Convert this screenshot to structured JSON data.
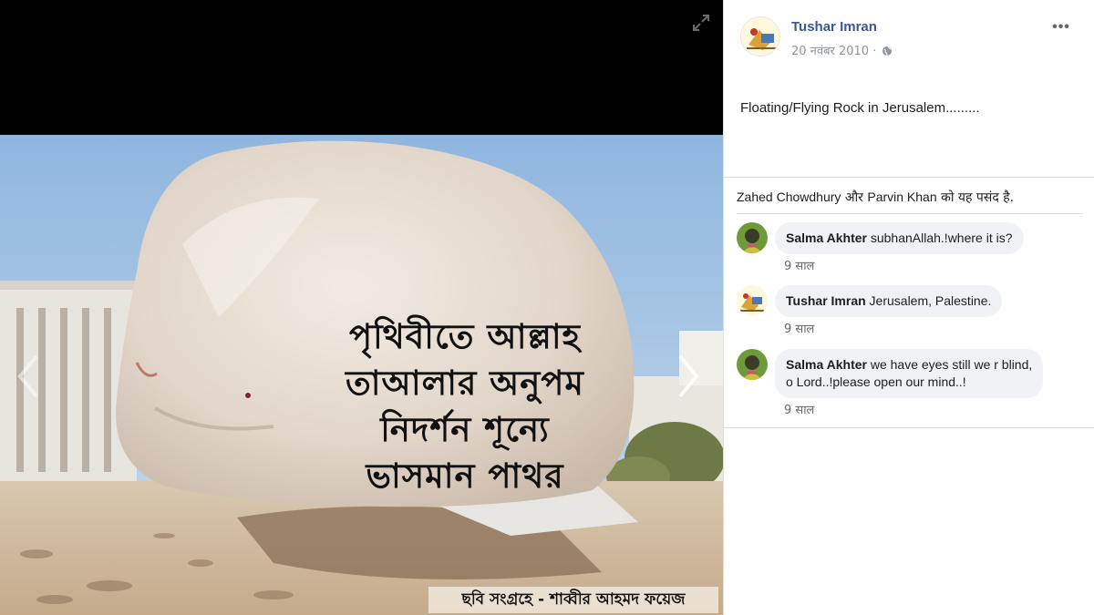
{
  "viewer": {
    "rock_caption_lines": [
      "পৃথিবীতে আল্লাহ",
      "তাআলার অনুপম",
      "নিদর্শন শূন্যে",
      "ভাসমান পাথর"
    ],
    "photo_credit": "ছবি সংগ্রহে - শাব্বীর আহমদ ফয়েজ",
    "expand_icon": "expand-icon",
    "prev_icon": "chevron-left-icon",
    "next_icon": "chevron-right-icon"
  },
  "post": {
    "author": "Tushar Imran",
    "date": "20 नवंबर 2010",
    "separator": " · ",
    "privacy_icon": "globe-icon",
    "more_label": "•••",
    "text": "Floating/Flying Rock in Jerusalem........."
  },
  "likes": {
    "name1": "Zahed Chowdhury",
    "connector": " और ",
    "name2": "Parvin Khan",
    "suffix": " को यह पसंद है."
  },
  "comments": [
    {
      "author": "Salma Akhter",
      "text": "subhanAllah.!where it is?",
      "time": "9 साल"
    },
    {
      "author": "Tushar Imran",
      "text": "Jerusalem, Palestine.",
      "time": "9 साल"
    },
    {
      "author": "Salma Akhter",
      "text_line1": "we have eyes still we r blind,",
      "text_line2": "o Lord..!please open our mind..!",
      "time": "9 साल"
    }
  ],
  "colors": {
    "link_blue": "#385898",
    "bubble_bg": "#f0f2f5",
    "meta_gray": "#90949c"
  }
}
